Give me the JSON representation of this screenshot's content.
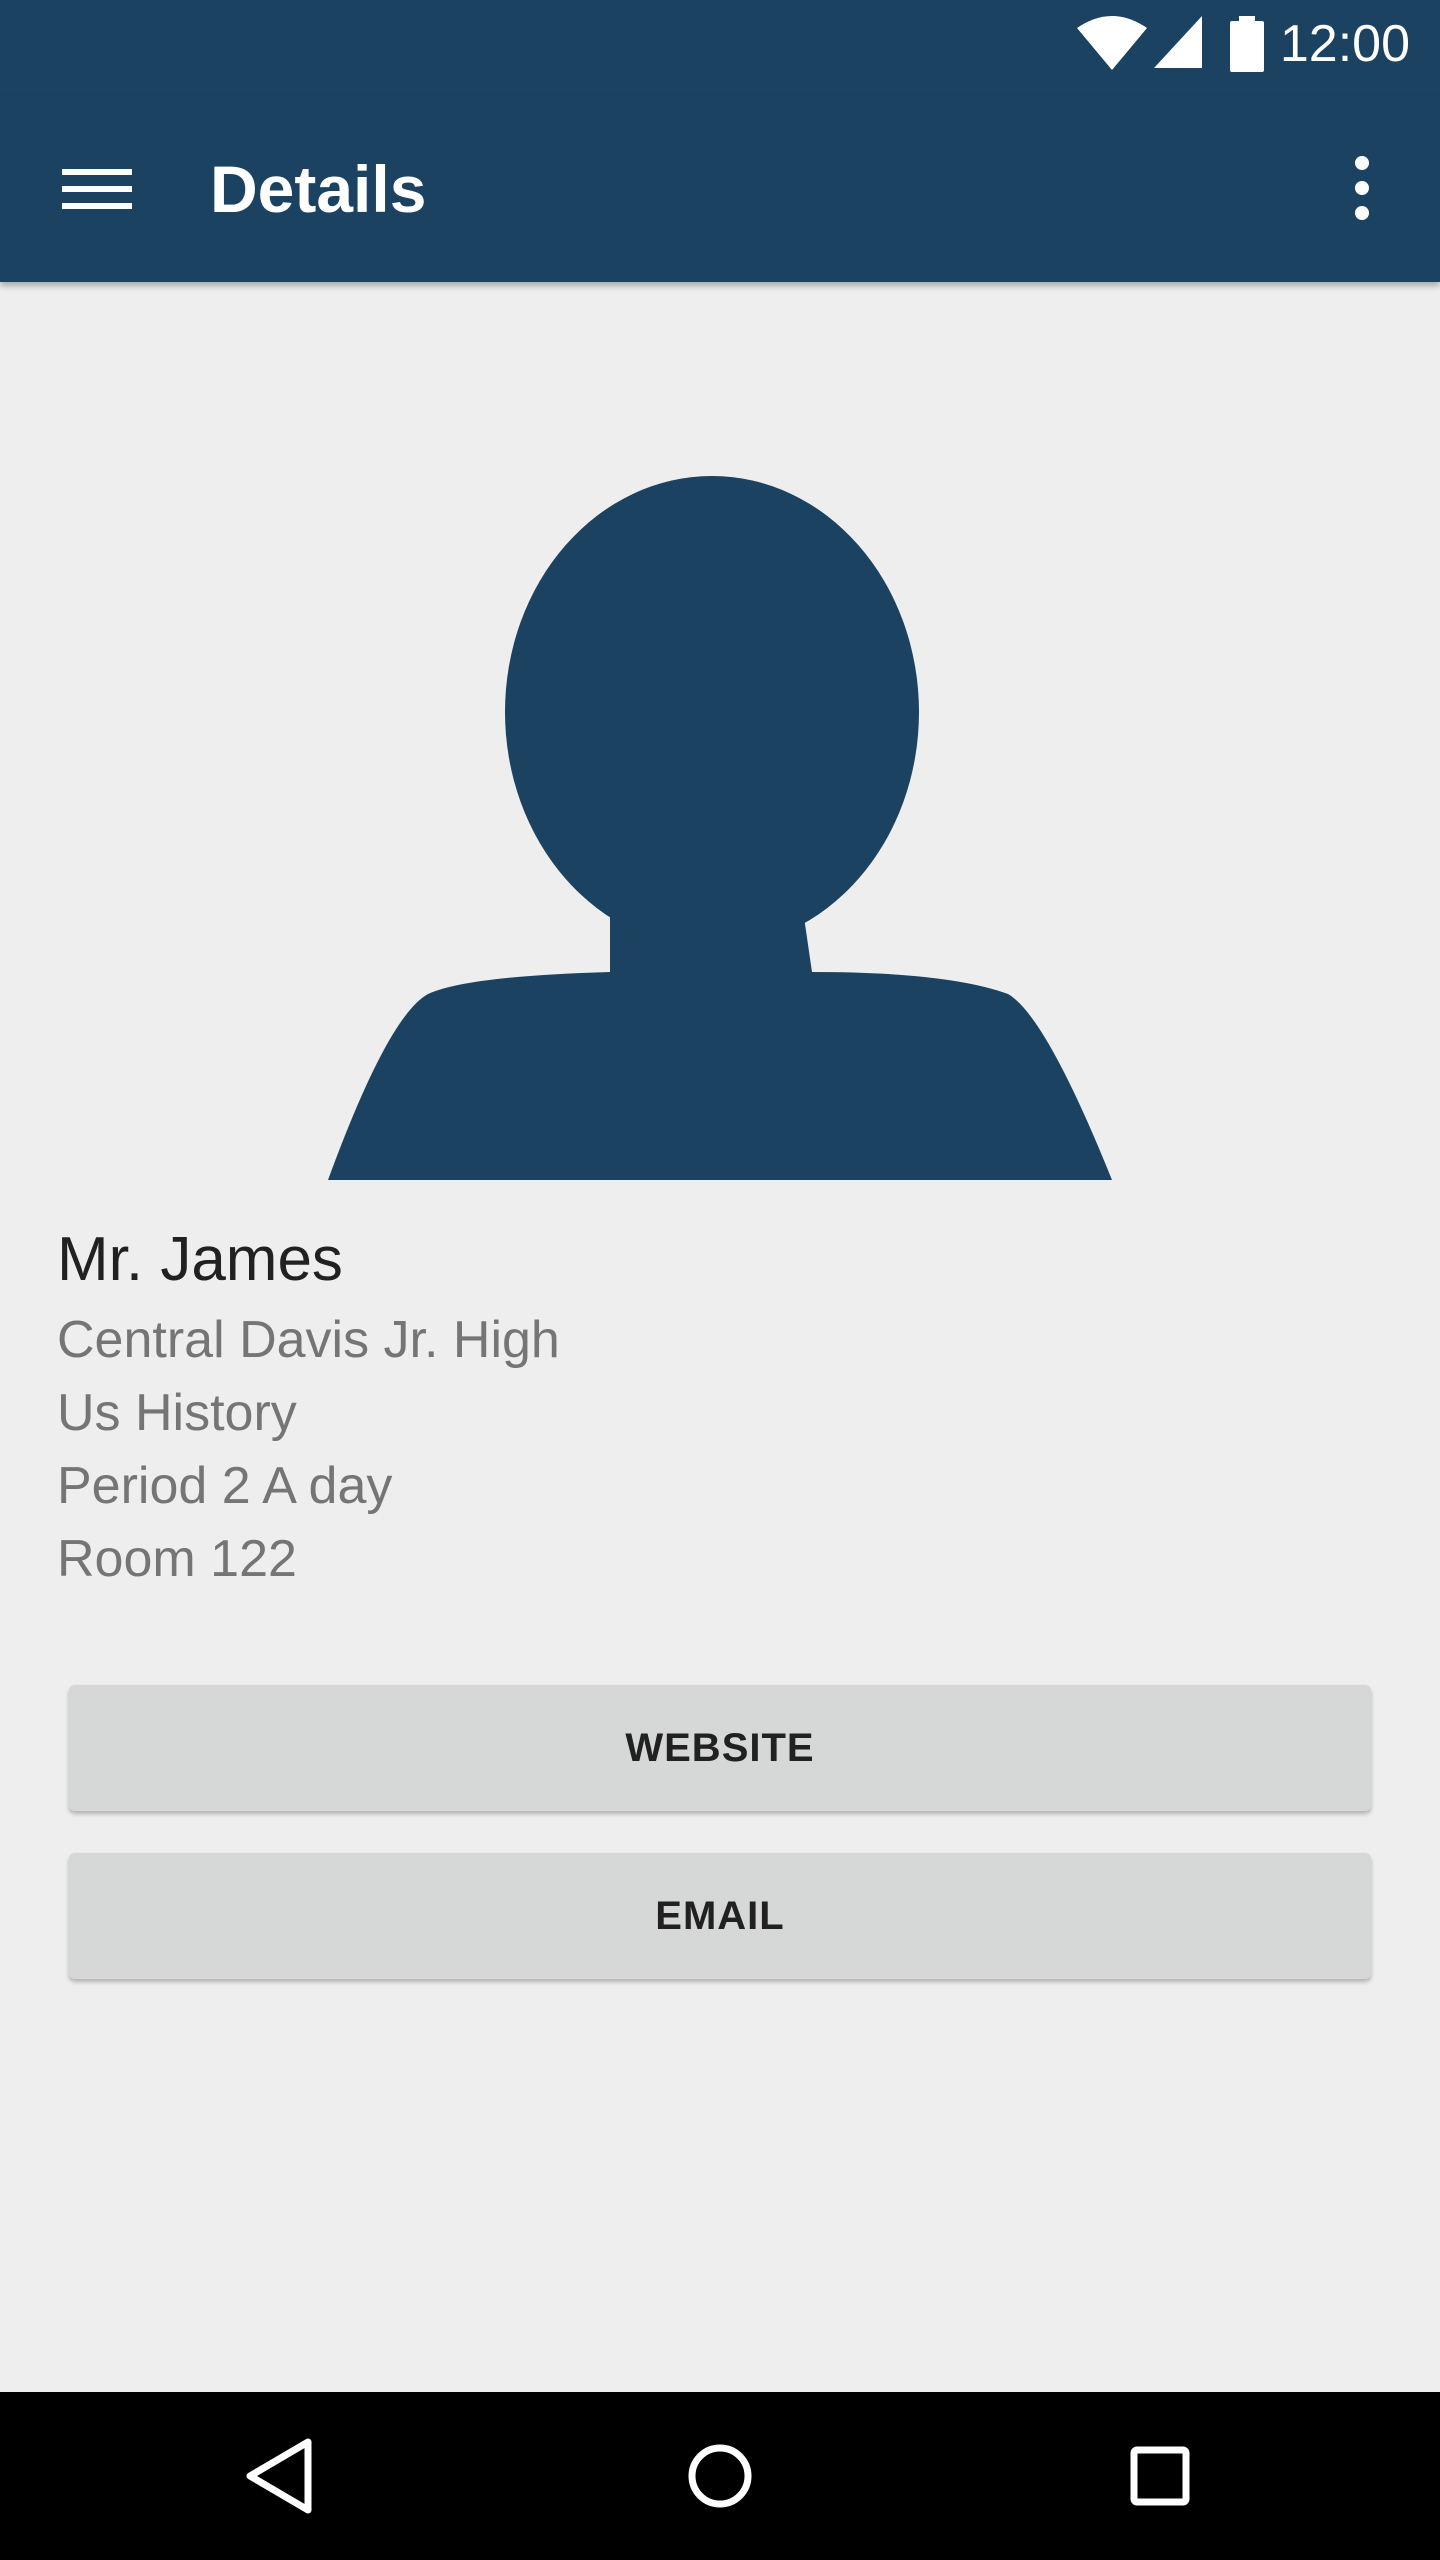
{
  "status_bar": {
    "time": "12:00",
    "icons": [
      "wifi-icon",
      "cell-signal-icon",
      "battery-icon"
    ]
  },
  "app_bar": {
    "title": "Details",
    "nav_icon": "menu-icon",
    "overflow_icon": "more-vert-icon"
  },
  "profile": {
    "avatar_icon": "person-silhouette-icon",
    "name": "Mr. James",
    "school": "Central Davis Jr. High",
    "subject": "Us History",
    "period": "Period 2 A day",
    "room": "Room 122"
  },
  "actions": {
    "website_label": "WEBSITE",
    "email_label": "EMAIL"
  },
  "nav_bar": {
    "icons": [
      "back-icon",
      "home-icon",
      "recents-icon"
    ]
  },
  "colors": {
    "primary": "#1b4361",
    "background": "#eeeeee",
    "button": "#d6d7d7",
    "text_primary": "#212121",
    "text_secondary": "#757575"
  }
}
